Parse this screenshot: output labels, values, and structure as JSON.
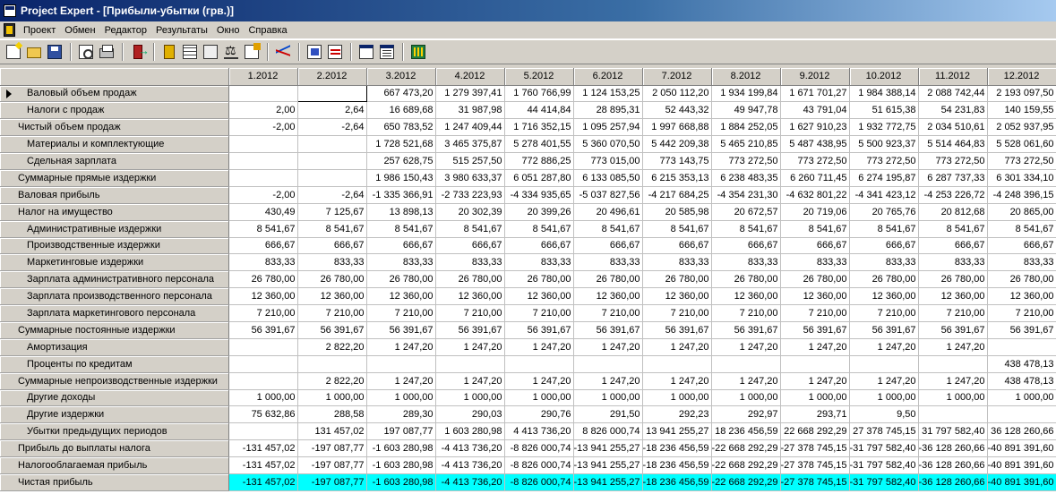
{
  "window": {
    "title": "Project Expert - [Прибыли-убытки (грв.)]"
  },
  "menu": [
    "Проект",
    "Обмен",
    "Редактор",
    "Результаты",
    "Окно",
    "Справка"
  ],
  "toolbar_icons": [
    "new-document-icon",
    "open-folder-icon",
    "save-disk-icon",
    "print-preview-icon",
    "printer-icon",
    "exit-icon",
    "book-icon",
    "table-grid-icon",
    "cash-flow-icon",
    "scales-icon",
    "edit-icon",
    "line-chart-icon",
    "report-icon",
    "report-list-icon",
    "window-icon",
    "window-list-icon",
    "calculator-icon"
  ],
  "table": {
    "columns": [
      "1.2012",
      "2.2012",
      "3.2012",
      "4.2012",
      "5.2012",
      "6.2012",
      "7.2012",
      "8.2012",
      "9.2012",
      "10.2012",
      "11.2012",
      "12.2012"
    ],
    "rows": [
      {
        "label": "Валовый объем продаж",
        "level": 1,
        "current": true,
        "values": [
          "",
          "",
          "667 473,20",
          "1 279 397,41",
          "1 760 766,99",
          "1 124 153,25",
          "2 050 112,20",
          "1 934 199,84",
          "1 671 701,27",
          "1 984 388,14",
          "2 088 742,44",
          "2 193 097,50"
        ]
      },
      {
        "label": "Налоги с продаж",
        "level": 1,
        "values": [
          "2,00",
          "2,64",
          "16 689,68",
          "31 987,98",
          "44 414,84",
          "28 895,31",
          "52 443,32",
          "49 947,78",
          "43 791,04",
          "51 615,38",
          "54 231,83",
          "140 159,55"
        ]
      },
      {
        "label": "Чистый объем продаж",
        "level": 0,
        "values": [
          "-2,00",
          "-2,64",
          "650 783,52",
          "1 247 409,44",
          "1 716 352,15",
          "1 095 257,94",
          "1 997 668,88",
          "1 884 252,05",
          "1 627 910,23",
          "1 932 772,75",
          "2 034 510,61",
          "2 052 937,95"
        ]
      },
      {
        "label": "Материалы и комплектующие",
        "level": 1,
        "values": [
          "",
          "",
          "1 728 521,68",
          "3 465 375,87",
          "5 278 401,55",
          "5 360 070,50",
          "5 442 209,38",
          "5 465 210,85",
          "5 487 438,95",
          "5 500 923,37",
          "5 514 464,83",
          "5 528 061,60"
        ]
      },
      {
        "label": "Сдельная зарплата",
        "level": 1,
        "values": [
          "",
          "",
          "257 628,75",
          "515 257,50",
          "772 886,25",
          "773 015,00",
          "773 143,75",
          "773 272,50",
          "773 272,50",
          "773 272,50",
          "773 272,50",
          "773 272,50"
        ]
      },
      {
        "label": "Суммарные прямые издержки",
        "level": 0,
        "values": [
          "",
          "",
          "1 986 150,43",
          "3 980 633,37",
          "6 051 287,80",
          "6 133 085,50",
          "6 215 353,13",
          "6 238 483,35",
          "6 260 711,45",
          "6 274 195,87",
          "6 287 737,33",
          "6 301 334,10"
        ]
      },
      {
        "label": "Валовая прибыль",
        "level": 0,
        "values": [
          "-2,00",
          "-2,64",
          "-1 335 366,91",
          "-2 733 223,93",
          "-4 334 935,65",
          "-5 037 827,56",
          "-4 217 684,25",
          "-4 354 231,30",
          "-4 632 801,22",
          "-4 341 423,12",
          "-4 253 226,72",
          "-4 248 396,15"
        ]
      },
      {
        "label": "Налог на имущество",
        "level": 0,
        "values": [
          "430,49",
          "7 125,67",
          "13 898,13",
          "20 302,39",
          "20 399,26",
          "20 496,61",
          "20 585,98",
          "20 672,57",
          "20 719,06",
          "20 765,76",
          "20 812,68",
          "20 865,00"
        ]
      },
      {
        "label": "Административные издержки",
        "level": 1,
        "values": [
          "8 541,67",
          "8 541,67",
          "8 541,67",
          "8 541,67",
          "8 541,67",
          "8 541,67",
          "8 541,67",
          "8 541,67",
          "8 541,67",
          "8 541,67",
          "8 541,67",
          "8 541,67"
        ]
      },
      {
        "label": "Производственные издержки",
        "level": 1,
        "values": [
          "666,67",
          "666,67",
          "666,67",
          "666,67",
          "666,67",
          "666,67",
          "666,67",
          "666,67",
          "666,67",
          "666,67",
          "666,67",
          "666,67"
        ]
      },
      {
        "label": "Маркетинговые издержки",
        "level": 1,
        "values": [
          "833,33",
          "833,33",
          "833,33",
          "833,33",
          "833,33",
          "833,33",
          "833,33",
          "833,33",
          "833,33",
          "833,33",
          "833,33",
          "833,33"
        ]
      },
      {
        "label": "Зарплата административного персонала",
        "level": 1,
        "values": [
          "26 780,00",
          "26 780,00",
          "26 780,00",
          "26 780,00",
          "26 780,00",
          "26 780,00",
          "26 780,00",
          "26 780,00",
          "26 780,00",
          "26 780,00",
          "26 780,00",
          "26 780,00"
        ]
      },
      {
        "label": "Зарплата производственного персонала",
        "level": 1,
        "values": [
          "12 360,00",
          "12 360,00",
          "12 360,00",
          "12 360,00",
          "12 360,00",
          "12 360,00",
          "12 360,00",
          "12 360,00",
          "12 360,00",
          "12 360,00",
          "12 360,00",
          "12 360,00"
        ]
      },
      {
        "label": "Зарплата маркетингового персонала",
        "level": 1,
        "values": [
          "7 210,00",
          "7 210,00",
          "7 210,00",
          "7 210,00",
          "7 210,00",
          "7 210,00",
          "7 210,00",
          "7 210,00",
          "7 210,00",
          "7 210,00",
          "7 210,00",
          "7 210,00"
        ]
      },
      {
        "label": "Суммарные постоянные издержки",
        "level": 0,
        "values": [
          "56 391,67",
          "56 391,67",
          "56 391,67",
          "56 391,67",
          "56 391,67",
          "56 391,67",
          "56 391,67",
          "56 391,67",
          "56 391,67",
          "56 391,67",
          "56 391,67",
          "56 391,67"
        ]
      },
      {
        "label": "Амортизация",
        "level": 1,
        "values": [
          "",
          "2 822,20",
          "1 247,20",
          "1 247,20",
          "1 247,20",
          "1 247,20",
          "1 247,20",
          "1 247,20",
          "1 247,20",
          "1 247,20",
          "1 247,20",
          ""
        ]
      },
      {
        "label": "Проценты по кредитам",
        "level": 1,
        "values": [
          "",
          "",
          "",
          "",
          "",
          "",
          "",
          "",
          "",
          "",
          "",
          "438 478,13"
        ]
      },
      {
        "label": "Суммарные непроизводственные издержки",
        "level": 0,
        "values": [
          "",
          "2 822,20",
          "1 247,20",
          "1 247,20",
          "1 247,20",
          "1 247,20",
          "1 247,20",
          "1 247,20",
          "1 247,20",
          "1 247,20",
          "1 247,20",
          "438 478,13"
        ]
      },
      {
        "label": "Другие доходы",
        "level": 1,
        "values": [
          "1 000,00",
          "1 000,00",
          "1 000,00",
          "1 000,00",
          "1 000,00",
          "1 000,00",
          "1 000,00",
          "1 000,00",
          "1 000,00",
          "1 000,00",
          "1 000,00",
          "1 000,00"
        ]
      },
      {
        "label": "Другие издержки",
        "level": 1,
        "values": [
          "75 632,86",
          "288,58",
          "289,30",
          "290,03",
          "290,76",
          "291,50",
          "292,23",
          "292,97",
          "293,71",
          "9,50",
          "",
          ""
        ]
      },
      {
        "label": "Убытки предыдущих периодов",
        "level": 1,
        "values": [
          "",
          "131 457,02",
          "197 087,77",
          "1 603 280,98",
          "4 413 736,20",
          "8 826 000,74",
          "13 941 255,27",
          "18 236 456,59",
          "22 668 292,29",
          "27 378 745,15",
          "31 797 582,40",
          "36 128 260,66"
        ]
      },
      {
        "label": "Прибыль до выплаты налога",
        "level": 0,
        "values": [
          "-131 457,02",
          "-197 087,77",
          "-1 603 280,98",
          "-4 413 736,20",
          "-8 826 000,74",
          "-13 941 255,27",
          "-18 236 456,59",
          "-22 668 292,29",
          "-27 378 745,15",
          "-31 797 582,40",
          "-36 128 260,66",
          "-40 891 391,60"
        ]
      },
      {
        "label": "Налогооблагаемая прибыль",
        "level": 0,
        "values": [
          "-131 457,02",
          "-197 087,77",
          "-1 603 280,98",
          "-4 413 736,20",
          "-8 826 000,74",
          "-13 941 255,27",
          "-18 236 456,59",
          "-22 668 292,29",
          "-27 378 745,15",
          "-31 797 582,40",
          "-36 128 260,66",
          "-40 891 391,60"
        ]
      },
      {
        "label": "Чистая прибыль",
        "level": 0,
        "highlight": true,
        "values": [
          "-131 457,02",
          "-197 087,77",
          "-1 603 280,98",
          "-4 413 736,20",
          "-8 826 000,74",
          "-13 941 255,27",
          "-18 236 456,59",
          "-22 668 292,29",
          "-27 378 745,15",
          "-31 797 582,40",
          "-36 128 260,66",
          "-40 891 391,60"
        ]
      }
    ]
  },
  "colors": {
    "highlight_row": "#00ffff",
    "title_bar": "#0a246a"
  }
}
